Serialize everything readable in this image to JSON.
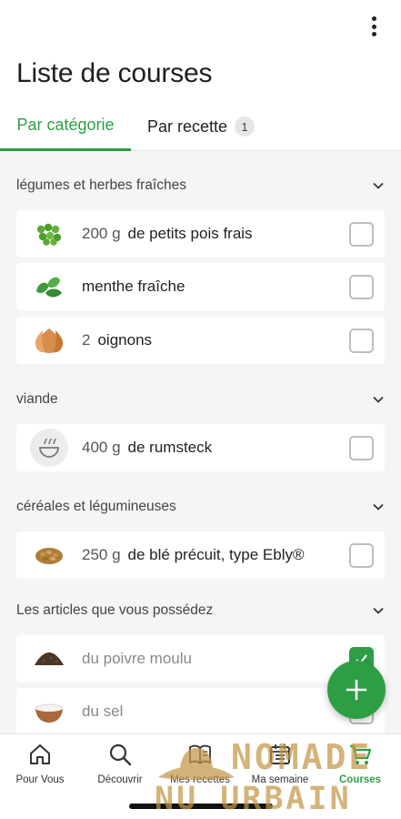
{
  "header": {
    "title": "Liste de courses",
    "menu_icon": "more-vertical-icon"
  },
  "tabs": [
    {
      "label": "Par catégorie",
      "active": true
    },
    {
      "label": "Par recette",
      "badge": "1",
      "active": false
    }
  ],
  "sections": [
    {
      "title": "légumes et herbes fraîches",
      "expanded": true,
      "items": [
        {
          "qty": "200 g",
          "name": "de petits pois frais",
          "icon": "peas-icon",
          "checked": false
        },
        {
          "qty": "",
          "name": "menthe fraîche",
          "icon": "mint-icon",
          "checked": false
        },
        {
          "qty": "2",
          "name": "oignons",
          "icon": "onion-icon",
          "checked": false
        }
      ]
    },
    {
      "title": "viande",
      "expanded": true,
      "items": [
        {
          "qty": "400 g",
          "name": "de rumsteck",
          "icon": "bowl-placeholder-icon",
          "checked": false
        }
      ]
    },
    {
      "title": "céréales et légumineuses",
      "expanded": true,
      "items": [
        {
          "qty": "250 g",
          "name": "de blé précuit, type Ebly®",
          "icon": "wheat-grains-icon",
          "checked": false
        }
      ]
    },
    {
      "title": "Les articles que vous possédez",
      "expanded": true,
      "items": [
        {
          "qty": "",
          "name": "du poivre moulu",
          "icon": "ground-pepper-icon",
          "checked": true
        },
        {
          "qty": "",
          "name": "du sel",
          "icon": "salt-bowl-icon",
          "checked": false
        }
      ]
    }
  ],
  "fab": {
    "icon": "plus-icon"
  },
  "bottom_nav": [
    {
      "label": "Pour Vous",
      "icon": "home-icon",
      "active": false
    },
    {
      "label": "Découvrir",
      "icon": "search-icon",
      "active": false
    },
    {
      "label": "Mes recettes",
      "icon": "book-icon",
      "active": false
    },
    {
      "label": "Ma semaine",
      "icon": "calendar-icon",
      "active": false
    },
    {
      "label": "Courses",
      "icon": "cart-icon",
      "active": true
    }
  ],
  "watermark": {
    "line1": "NOMADE",
    "line2": "NU URBAIN",
    "icon": "hat-logo-icon"
  },
  "colors": {
    "accent": "#2e9e45",
    "background": "#f5f5f5",
    "card": "#ffffff",
    "watermark": "#c49646"
  }
}
